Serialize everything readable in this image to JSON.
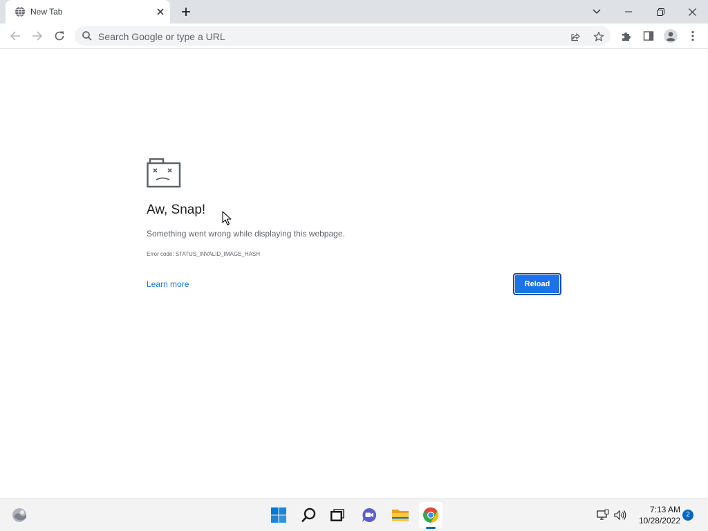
{
  "browser": {
    "tab": {
      "title": "New Tab",
      "favicon": "globe-icon",
      "close_icon": "close-icon"
    },
    "new_tab_icon": "plus-icon",
    "window_controls": [
      "chevron-down-icon",
      "minimize-icon",
      "restore-icon",
      "close-icon"
    ],
    "toolbar": {
      "back_icon": "back-arrow-icon",
      "forward_icon": "forward-arrow-icon",
      "reload_icon": "reload-icon",
      "omnibox_placeholder": "Search Google or type a URL",
      "share_icon": "share-icon",
      "bookmark_icon": "star-icon",
      "extensions_icon": "puzzle-icon",
      "side_panel_icon": "side-panel-icon",
      "profile_icon": "avatar-icon",
      "menu_icon": "kebab-menu-icon"
    }
  },
  "error_page": {
    "icon": "sad-tab-icon",
    "title": "Aw, Snap!",
    "message": "Something went wrong while displaying this webpage.",
    "error_code": "Error code: STATUS_INVALID_IMAGE_HASH",
    "learn_more": "Learn more",
    "reload_label": "Reload",
    "accent": "#1a73e8"
  },
  "taskbar": {
    "widgets_icon": "widgets-icon",
    "apps": [
      {
        "name": "start",
        "icon": "windows-start-icon"
      },
      {
        "name": "search",
        "icon": "search-icon"
      },
      {
        "name": "task-view",
        "icon": "task-view-icon"
      },
      {
        "name": "chat",
        "icon": "chat-icon"
      },
      {
        "name": "file-explorer",
        "icon": "folder-icon"
      },
      {
        "name": "chrome",
        "icon": "chrome-icon",
        "active": true
      }
    ],
    "tray": {
      "network_icon": "network-icon",
      "volume_icon": "volume-icon"
    },
    "time": "7:13 AM",
    "date": "10/28/2022",
    "notification_count": "2"
  }
}
